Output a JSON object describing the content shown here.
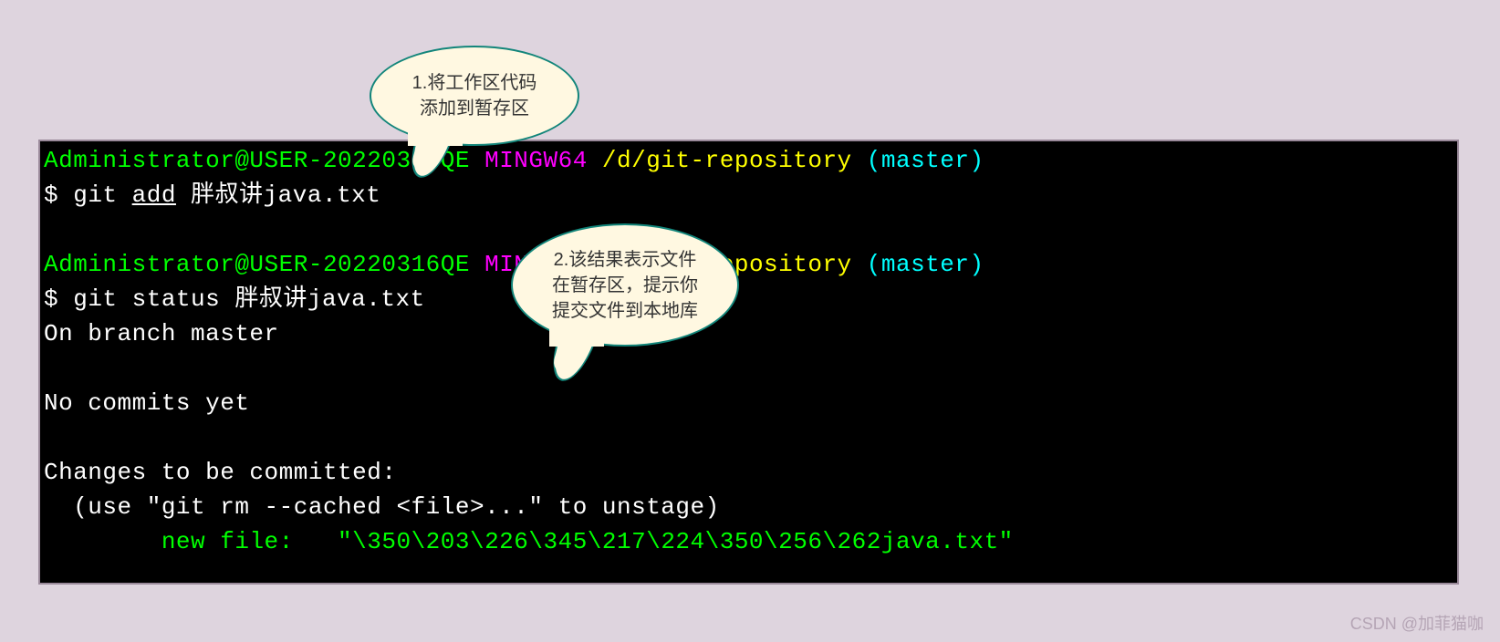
{
  "callouts": {
    "bubble1": {
      "line1": "1.将工作区代码",
      "line2": "添加到暂存区"
    },
    "bubble2": {
      "line1": "2.该结果表示文件",
      "line2": "在暂存区，提示你",
      "line3": "提交文件到本地库"
    }
  },
  "terminal": {
    "prompt1": {
      "user_host": "Administrator@USER-20220316QE",
      "shell": " MINGW64",
      "path": " /d/git-repository",
      "branch": " (master)"
    },
    "cmd1": {
      "dollar": "$ ",
      "command": "git ",
      "subcommand": "add",
      "args": " 胖叔讲java.txt"
    },
    "prompt2": {
      "user_host": "Administrator@USER-20220316QE",
      "shell": " MINGW64",
      "path": " /d/git-repository",
      "branch": " (master)"
    },
    "cmd2": {
      "dollar": "$ ",
      "full": "git status 胖叔讲java.txt"
    },
    "out1": "On branch master",
    "out2": "No commits yet",
    "out3": "Changes to be committed:",
    "out4": "  (use \"git rm --cached <file>...\" to unstage)",
    "out5_prefix": "        ",
    "out5_green": "new file:   \"\\350\\203\\226\\345\\217\\224\\350\\256\\262java.txt\""
  },
  "watermark": "CSDN @加菲猫咖"
}
